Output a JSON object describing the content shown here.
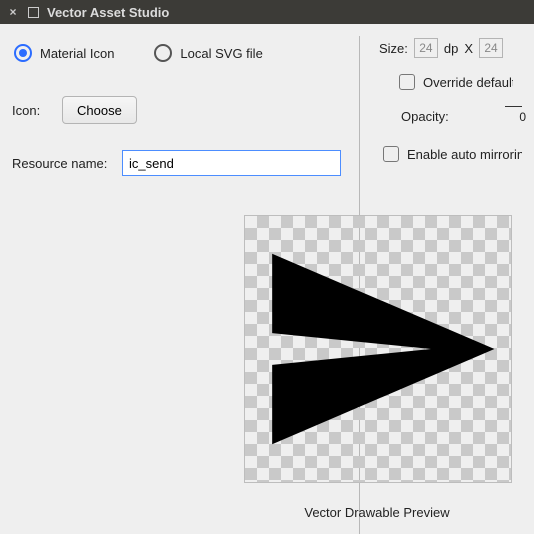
{
  "window": {
    "title": "Vector Asset Studio",
    "close_icon": "×"
  },
  "radios": {
    "material": "Material Icon",
    "svg": "Local SVG file",
    "selected": "material"
  },
  "icon": {
    "label": "Icon:",
    "choose_btn": "Choose"
  },
  "resource": {
    "label": "Resource name:",
    "value": "ic_send"
  },
  "size": {
    "label": "Size:",
    "w": "24",
    "unit": "dp",
    "sep": "X",
    "h": "24"
  },
  "override": {
    "label": "Override default size from Material Design"
  },
  "opacity": {
    "label": "Opacity:",
    "value": "0"
  },
  "mirror": {
    "label": "Enable auto mirroring for RTL layout"
  },
  "preview": {
    "caption": "Vector Drawable Preview",
    "icon": "ic_send"
  }
}
